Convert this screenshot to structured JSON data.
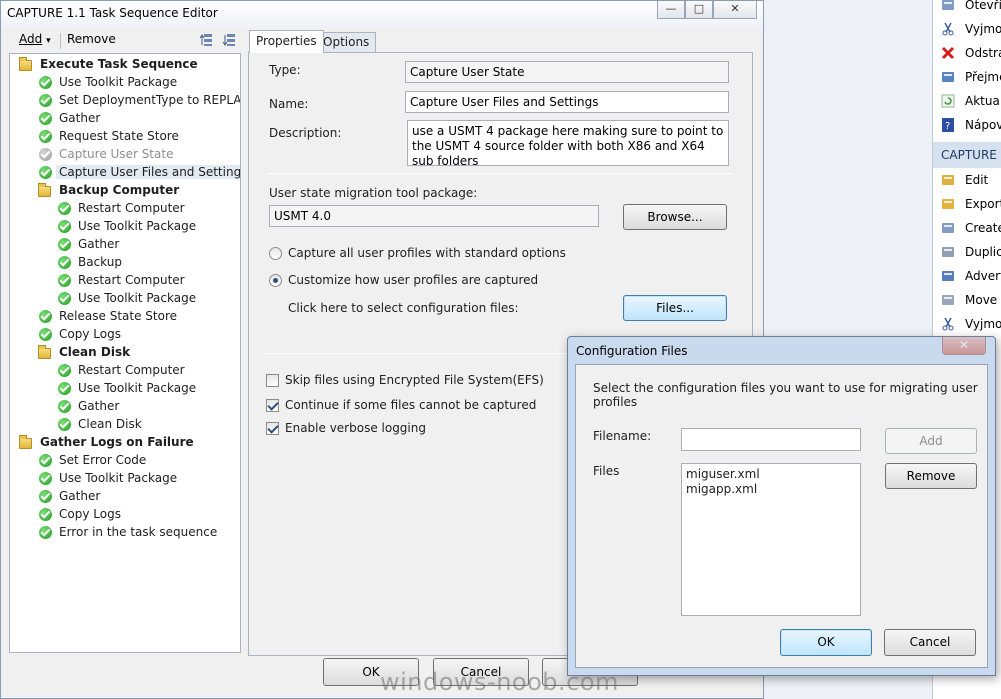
{
  "editor": {
    "title": "CAPTURE 1.1 Task Sequence Editor",
    "minimize_glyph": "—",
    "maximize_glyph": "□",
    "close_glyph": "✕",
    "toolbar": {
      "add": "Add",
      "add_arrow": "▾",
      "remove": "Remove"
    },
    "tree": [
      {
        "label": "Execute Task Sequence",
        "kind": "group",
        "level": 0
      },
      {
        "label": "Use Toolkit Package",
        "kind": "step",
        "level": 1
      },
      {
        "label": "Set DeploymentType to REPLACE",
        "kind": "step",
        "level": 1
      },
      {
        "label": "Gather",
        "kind": "step",
        "level": 1
      },
      {
        "label": "Request State Store",
        "kind": "step",
        "level": 1
      },
      {
        "label": "Capture User State",
        "kind": "disabled",
        "level": 1
      },
      {
        "label": "Capture User Files and Settings",
        "kind": "selected",
        "level": 1
      },
      {
        "label": "Backup Computer",
        "kind": "group",
        "level": 1
      },
      {
        "label": "Restart Computer",
        "kind": "step",
        "level": 2
      },
      {
        "label": "Use Toolkit Package",
        "kind": "step",
        "level": 2
      },
      {
        "label": "Gather",
        "kind": "step",
        "level": 2
      },
      {
        "label": "Backup",
        "kind": "step",
        "level": 2
      },
      {
        "label": "Restart Computer",
        "kind": "step",
        "level": 2
      },
      {
        "label": "Use Toolkit Package",
        "kind": "step",
        "level": 2
      },
      {
        "label": "Release State Store",
        "kind": "step",
        "level": 1
      },
      {
        "label": "Copy Logs",
        "kind": "step",
        "level": 1
      },
      {
        "label": "Clean Disk",
        "kind": "group",
        "level": 1
      },
      {
        "label": "Restart Computer",
        "kind": "step",
        "level": 2
      },
      {
        "label": "Use Toolkit Package",
        "kind": "step",
        "level": 2
      },
      {
        "label": "Gather",
        "kind": "step",
        "level": 2
      },
      {
        "label": "Clean Disk",
        "kind": "step",
        "level": 2
      },
      {
        "label": "Gather Logs on Failure",
        "kind": "group",
        "level": 0
      },
      {
        "label": "Set Error Code",
        "kind": "step",
        "level": 1
      },
      {
        "label": "Use Toolkit Package",
        "kind": "step",
        "level": 1
      },
      {
        "label": "Gather",
        "kind": "step",
        "level": 1
      },
      {
        "label": "Copy Logs",
        "kind": "step",
        "level": 1
      },
      {
        "label": "Error in the task sequence",
        "kind": "step",
        "level": 1
      }
    ],
    "tabs": {
      "properties": "Properties",
      "options": "Options"
    },
    "props": {
      "type_label": "Type:",
      "type_value": "Capture User State",
      "name_label": "Name:",
      "name_value": "Capture User Files and Settings",
      "description_label": "Description:",
      "description_value": "use a USMT 4 package here making sure to point to the USMT 4 source folder with both X86 and X64 sub folders",
      "usmt_label": "User state migration tool package:",
      "usmt_value": "USMT 4.0",
      "browse_button": "Browse...",
      "radio_all": "Capture all user profiles with standard options",
      "radio_custom": "Customize how user profiles are captured",
      "config_hint": "Click here to select configuration files:",
      "files_button": "Files...",
      "chk_efs": "Skip files using Encrypted File System(EFS)",
      "chk_continue": "Continue if some files cannot be captured",
      "chk_verbose": "Enable verbose logging",
      "radio_selected": "custom",
      "chk_efs_checked": false,
      "chk_continue_checked": true,
      "chk_verbose_checked": true
    },
    "footer": {
      "ok": "OK",
      "cancel": "Cancel"
    }
  },
  "console": {
    "items_top": [
      {
        "label": "Otevřít",
        "icon": "open-icon"
      },
      {
        "label": "Vyjmout",
        "icon": "cut-icon"
      },
      {
        "label": "Odstranit",
        "icon": "delete-icon"
      },
      {
        "label": "Přejmenovat",
        "icon": "rename-icon"
      },
      {
        "label": "Aktualizovat",
        "icon": "refresh-icon"
      },
      {
        "label": "Nápověda",
        "icon": "help-icon"
      }
    ],
    "section": "CAPTURE 1.1",
    "items_section": [
      {
        "label": "Edit",
        "icon": "edit-icon"
      },
      {
        "label": "Export",
        "icon": "export-icon"
      },
      {
        "label": "Create",
        "icon": "create-icon"
      },
      {
        "label": "Duplicate",
        "icon": "duplicate-icon"
      },
      {
        "label": "Advertise",
        "icon": "advertise-icon"
      },
      {
        "label": "Move Item",
        "icon": "move-icon"
      },
      {
        "label": "Vyjmout",
        "icon": "cut-icon"
      }
    ]
  },
  "config_dialog": {
    "title": "Configuration Files",
    "close_glyph": "✕",
    "instructions": "Select the configuration files you want to use for migrating user profiles",
    "filename_label": "Filename:",
    "filename_value": "",
    "add_button": "Add",
    "files_label": "Files",
    "files": [
      "miguser.xml",
      "migapp.xml"
    ],
    "remove_button": "Remove",
    "ok": "OK",
    "cancel": "Cancel"
  },
  "watermark": "windows-noob.com",
  "colors": {
    "accent": "#3c7fb1",
    "dialog_frame": "#c9d9ee",
    "check_green": "#1d9a1c"
  }
}
